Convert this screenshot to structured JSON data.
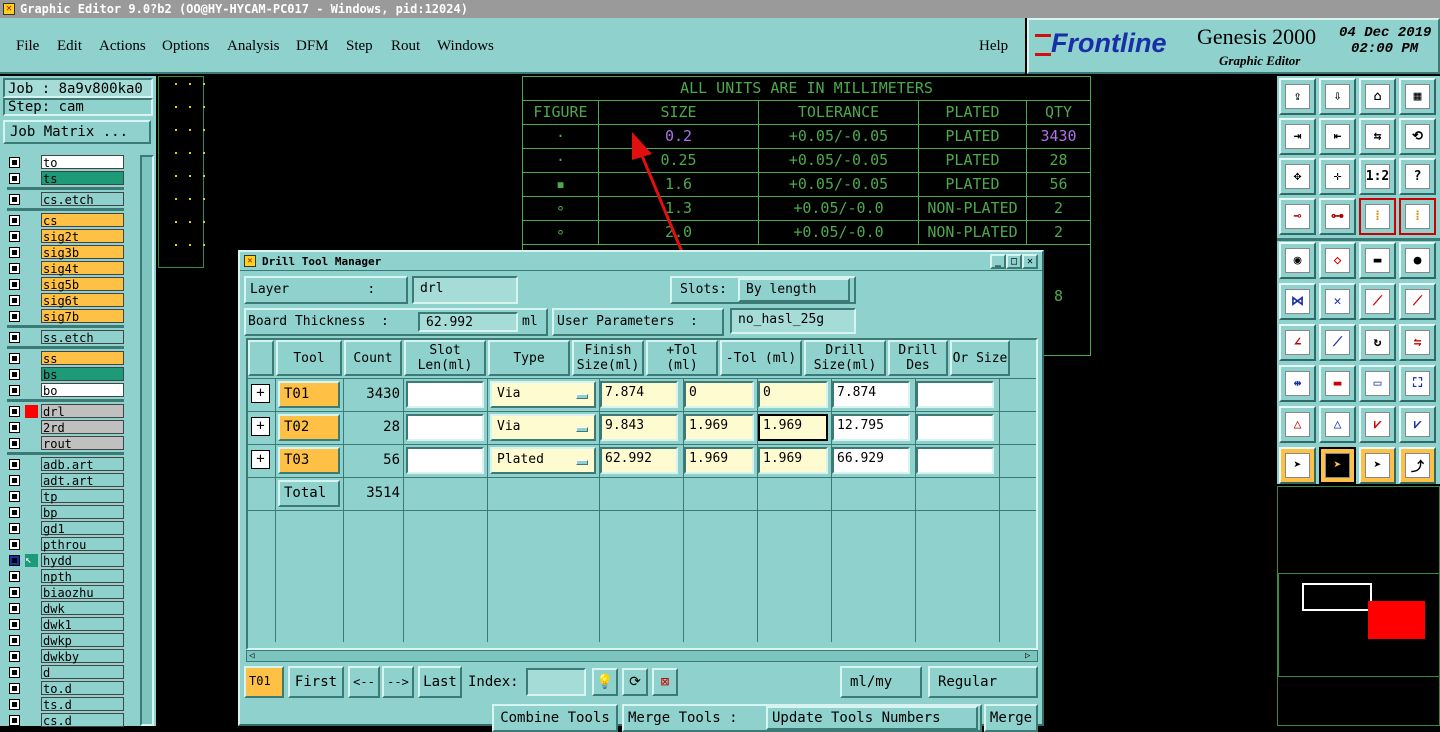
{
  "window_title": "Graphic Editor 9.0?b2 (OO@HY-HYCAM-PC017 - Windows, pid:12024)",
  "menu": [
    "File",
    "Edit",
    "Actions",
    "Options",
    "Analysis",
    "DFM",
    "Step",
    "Rout",
    "Windows"
  ],
  "help": "Help",
  "brand": {
    "logo": "Frontline",
    "product": "Genesis 2000",
    "subtitle": "Graphic Editor",
    "date": "04 Dec 2019",
    "time": "02:00 PM"
  },
  "job": {
    "job_label": "Job : 8a9v800ka0",
    "step_label": "Step: cam",
    "matrix_button": "Job Matrix ..."
  },
  "layers": [
    {
      "name": "to",
      "color": "#ffffff"
    },
    {
      "name": "ts",
      "color": "#1f9a79"
    },
    {
      "name": "cs.etch",
      "color": "#8fd1cc"
    },
    {
      "name": "cs",
      "color": "#ffc145"
    },
    {
      "name": "sig2t",
      "color": "#ffc145"
    },
    {
      "name": "sig3b",
      "color": "#ffc145"
    },
    {
      "name": "sig4t",
      "color": "#ffc145"
    },
    {
      "name": "sig5b",
      "color": "#ffc145"
    },
    {
      "name": "sig6t",
      "color": "#ffc145"
    },
    {
      "name": "sig7b",
      "color": "#ffc145"
    },
    {
      "name": "ss.etch",
      "color": "#8fd1cc"
    },
    {
      "name": "ss",
      "color": "#ffc145"
    },
    {
      "name": "bs",
      "color": "#1f9a79"
    },
    {
      "name": "bo",
      "color": "#ffffff"
    },
    {
      "name": "drl",
      "color": "#c0c0c0"
    },
    {
      "name": "2rd",
      "color": "#c0c0c0"
    },
    {
      "name": "rout",
      "color": "#c0c0c0"
    },
    {
      "name": "adb.art",
      "color": "#8fd1cc"
    },
    {
      "name": "adt.art",
      "color": "#8fd1cc"
    },
    {
      "name": "tp",
      "color": "#8fd1cc"
    },
    {
      "name": "bp",
      "color": "#8fd1cc"
    },
    {
      "name": "gd1",
      "color": "#8fd1cc"
    },
    {
      "name": "pthrou",
      "color": "#8fd1cc"
    },
    {
      "name": "hydd",
      "color": "#8fd1cc"
    },
    {
      "name": "npth",
      "color": "#8fd1cc"
    },
    {
      "name": "biaozhu",
      "color": "#8fd1cc"
    },
    {
      "name": "dwk",
      "color": "#8fd1cc"
    },
    {
      "name": "dwk1",
      "color": "#8fd1cc"
    },
    {
      "name": "dwkp",
      "color": "#8fd1cc"
    },
    {
      "name": "dwkby",
      "color": "#8fd1cc"
    },
    {
      "name": "d",
      "color": "#8fd1cc"
    },
    {
      "name": "to.d",
      "color": "#8fd1cc"
    },
    {
      "name": "ts.d",
      "color": "#8fd1cc"
    },
    {
      "name": "cs.d",
      "color": "#8fd1cc"
    }
  ],
  "drill_table": {
    "banner": "ALL UNITS ARE IN MILLIMETERS",
    "headers": [
      "FIGURE",
      "SIZE",
      "TOLERANCE",
      "PLATED",
      "QTY"
    ],
    "rows": [
      {
        "figure": "·",
        "size": "0.2",
        "tol": "+0.05/-0.05",
        "plated": "PLATED",
        "qty": "3430"
      },
      {
        "figure": "·",
        "size": "0.25",
        "tol": "+0.05/-0.05",
        "plated": "PLATED",
        "qty": "28"
      },
      {
        "figure": "▪",
        "size": "1.6",
        "tol": "+0.05/-0.05",
        "plated": "PLATED",
        "qty": "56"
      },
      {
        "figure": "∘",
        "size": "1.3",
        "tol": "+0.05/-0.0",
        "plated": "NON-PLATED",
        "qty": "2"
      },
      {
        "figure": "∘",
        "size": "2.0",
        "tol": "+0.05/-0.0",
        "plated": "NON-PLATED",
        "qty": "2"
      }
    ],
    "total": "8"
  },
  "dialog": {
    "title": "Drill Tool Manager",
    "layer_label": "Layer          :",
    "layer_value": "drl",
    "slots_label": "Slots:",
    "slots_value": "By length",
    "thickness_label": "Board Thickness  :",
    "thickness_value": "62.992",
    "thickness_unit": "ml",
    "user_params_label": "User Parameters  :",
    "user_params_value": "no_hasl_25g",
    "columns": [
      "Tool",
      "Count",
      "Slot Len(ml)",
      "Type",
      "Finish Size(ml)",
      "+Tol (ml)",
      "-Tol (ml)",
      "Drill Size(ml)",
      "Drill Des",
      "Or Size"
    ],
    "tools": [
      {
        "tool": "T01",
        "count": "3430",
        "slot": "",
        "type": "Via",
        "finish": "7.874",
        "ptol": "0",
        "mtol": "0",
        "drill": "7.874",
        "des": ""
      },
      {
        "tool": "T02",
        "count": "28",
        "slot": "",
        "type": "Via",
        "finish": "9.843",
        "ptol": "1.969",
        "mtol": "1.969",
        "drill": "12.795",
        "des": ""
      },
      {
        "tool": "T03",
        "count": "56",
        "slot": "",
        "type": "Plated",
        "finish": "62.992",
        "ptol": "1.969",
        "mtol": "1.969",
        "drill": "66.929",
        "des": ""
      }
    ],
    "total_label": "Total",
    "total_count": "3514",
    "current_tool": "T01",
    "nav": {
      "first": "First",
      "prev": "<--",
      "next": "-->",
      "last": "Last",
      "index_label": "Index:",
      "index_value": ""
    },
    "unit_value": "ml/my",
    "mode_value": "Regular",
    "bottom": {
      "combine": "Combine Tools",
      "merge_label": "Merge Tools :",
      "update": "Update Tools Numbers",
      "merge": "Merge"
    }
  },
  "toolbar_icons": [
    "open-icon",
    "save-icon",
    "home-icon",
    "window-icon",
    "import-icon",
    "export-icon",
    "swap-icon",
    "refresh-icon",
    "fit-icon",
    "zoom-icon",
    "scale-1-2-icon",
    "help-icon",
    "measure-icon",
    "probe-icon",
    "traffic-light-icon",
    "traffic-light-alt-icon",
    "pad-icon",
    "polygon-icon",
    "ruler-icon",
    "dot-icon",
    "connect-icon",
    "cross-icon",
    "line-dot-icon",
    "line-dot-alt-icon",
    "angle-icon",
    "slash-icon",
    "arc-icon",
    "mirror-icon",
    "split-icon",
    "bar-icon",
    "frame-icon",
    "group-icon",
    "triangle-icon",
    "triangle-alt-icon",
    "triangle-arc-icon",
    "triangle-arc-alt-icon",
    "pointer-icon",
    "pointer-select-icon",
    "pointer-box-icon",
    "pointer-route-icon"
  ]
}
